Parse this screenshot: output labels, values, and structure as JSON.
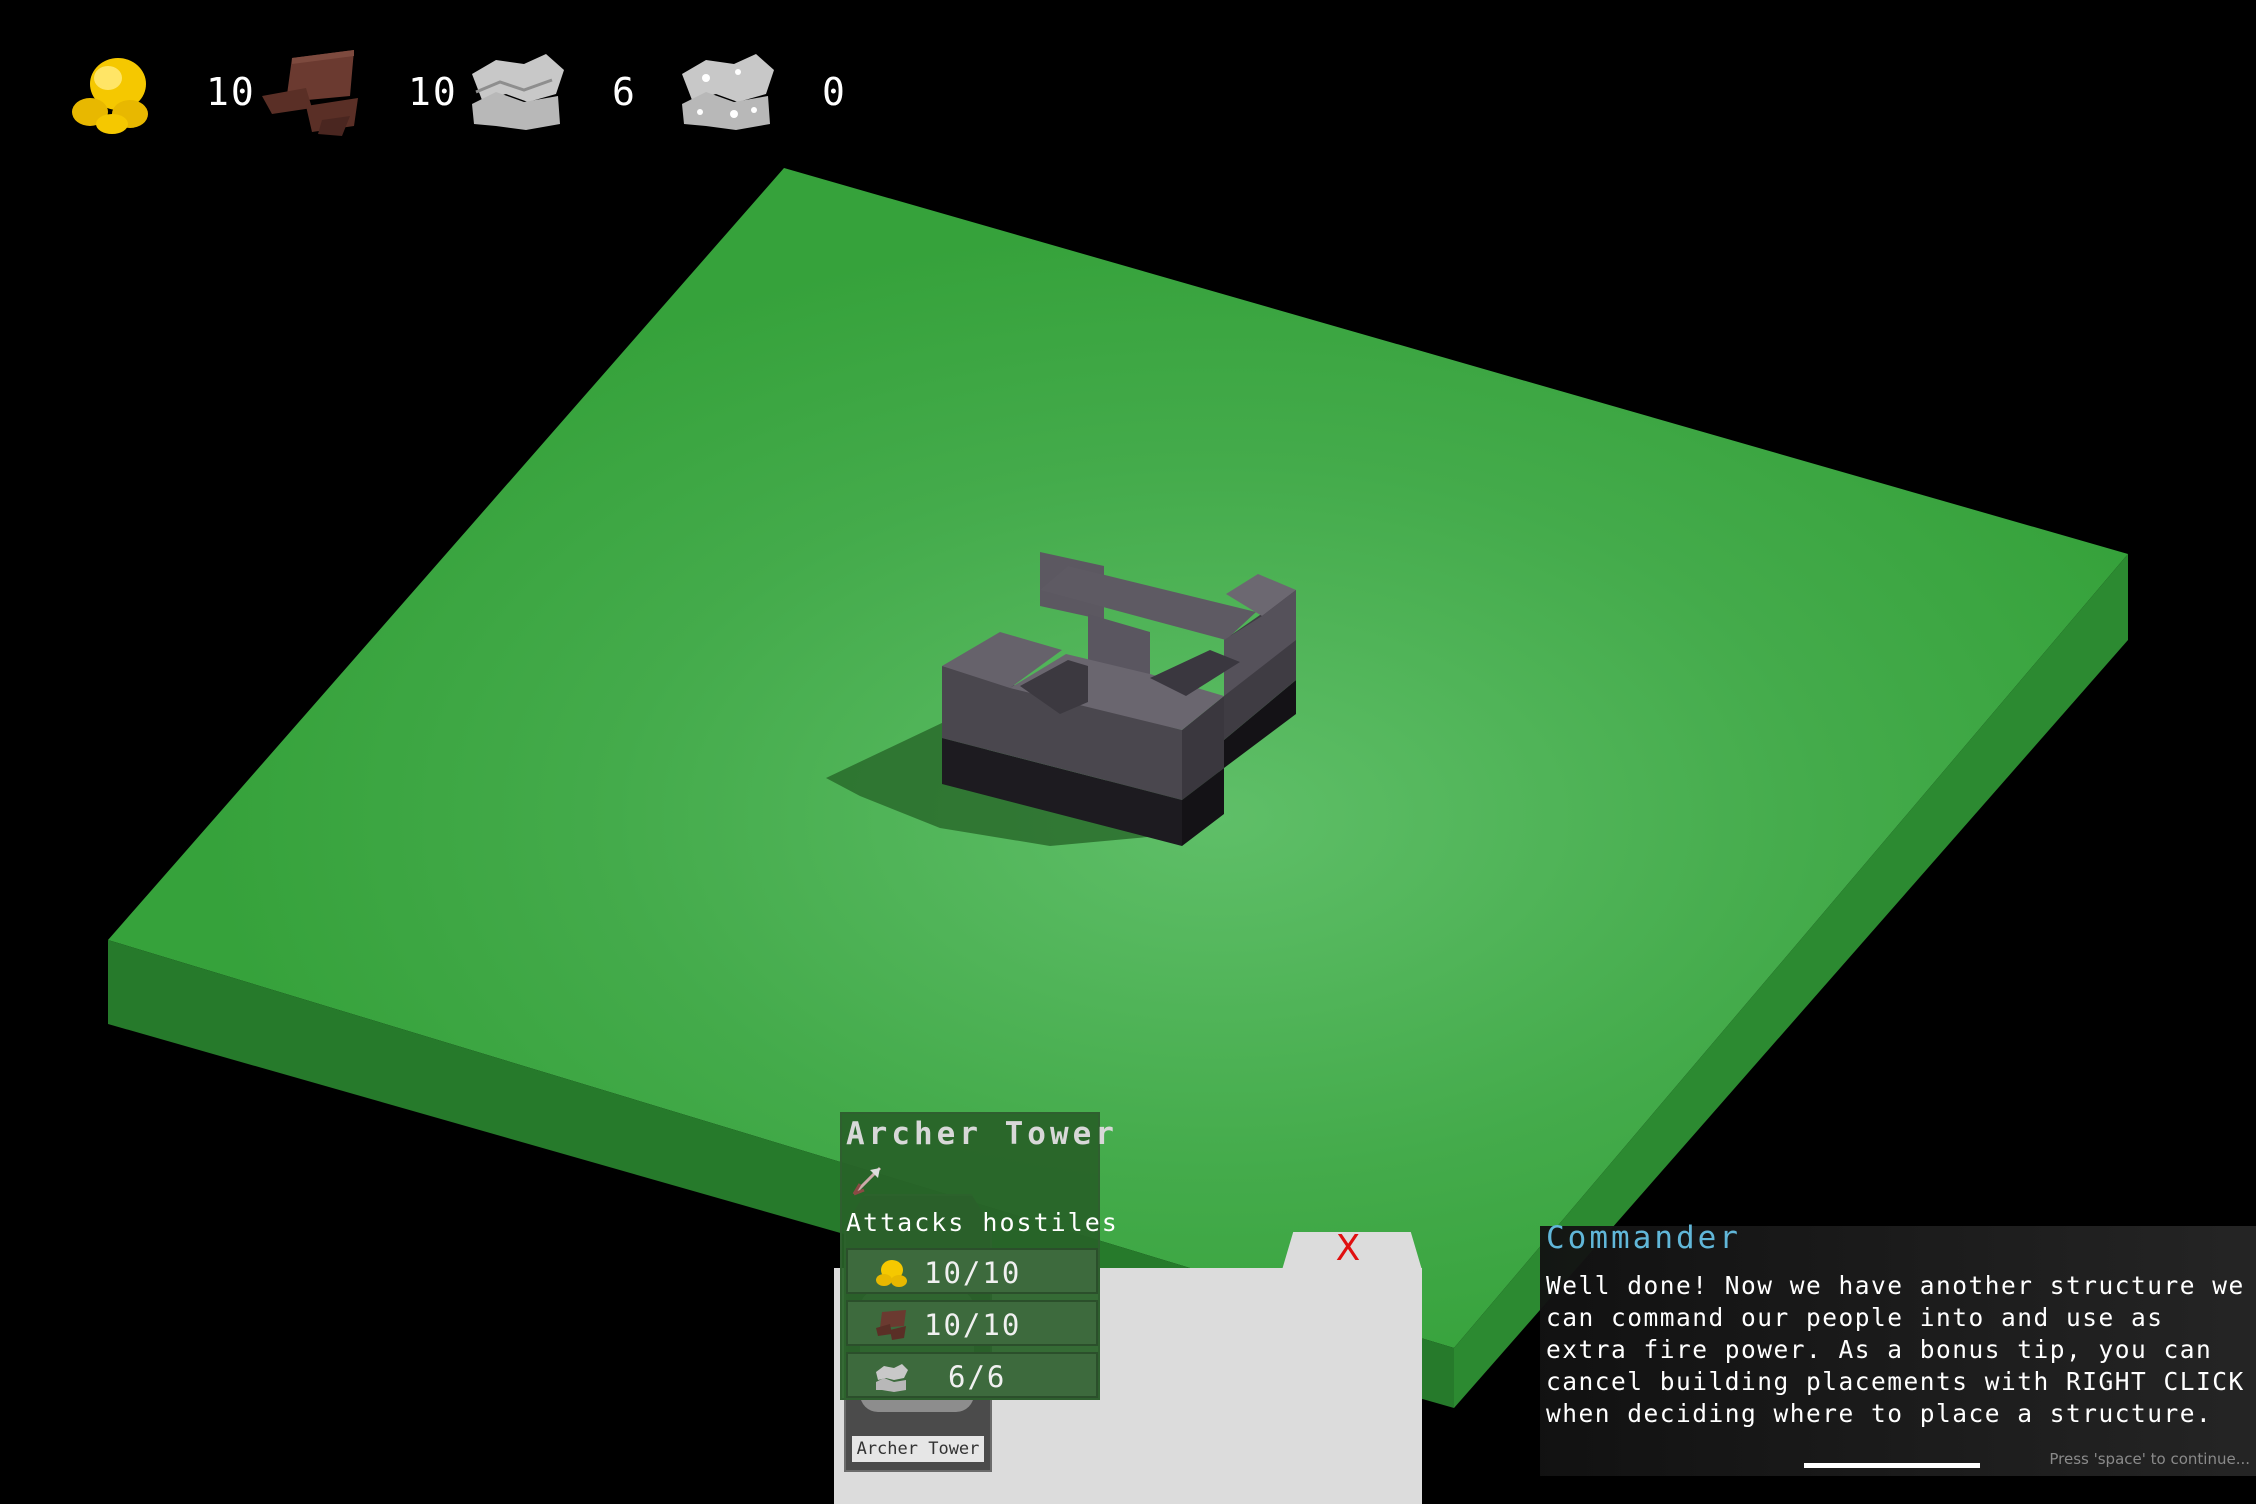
{
  "hud": {
    "resources": [
      {
        "name": "gold",
        "icon": "gold-coins-icon",
        "count": "10",
        "color": "#f5c800"
      },
      {
        "name": "wood",
        "icon": "wood-planks-icon",
        "count": "10",
        "color": "#5a2f26"
      },
      {
        "name": "stone",
        "icon": "stone-icon",
        "count": "6",
        "color": "#c8c8c8"
      },
      {
        "name": "ore",
        "icon": "ore-icon",
        "count": "0",
        "color": "#c8c8c8"
      }
    ]
  },
  "scene": {
    "ground_color": "#3aa43f",
    "structure": "stone-fort"
  },
  "build_menu": {
    "close_label": "X",
    "items": [
      {
        "label": "Archer Tower",
        "icon": "archer-tower-icon"
      }
    ]
  },
  "tooltip": {
    "title": "Archer Tower",
    "type_icon": "arrow-icon",
    "description": "Attacks hostiles",
    "costs": [
      {
        "icon": "gold-coins-icon",
        "value": "10/10"
      },
      {
        "icon": "wood-planks-icon",
        "value": "10/10"
      },
      {
        "icon": "stone-icon",
        "value": "6/6"
      }
    ]
  },
  "dialog": {
    "speaker": "Commander",
    "text": "Well done! Now we have another structure we can command our people into and use as extra fire power. As a bonus tip, you can cancel building placements with RIGHT CLICK when deciding where to place a structure.",
    "hint": "Press 'space' to continue..."
  }
}
